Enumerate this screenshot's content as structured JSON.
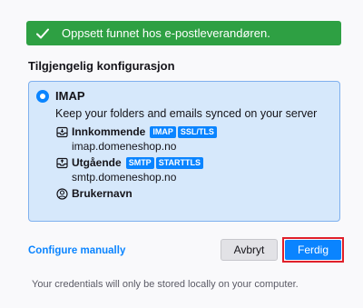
{
  "banner": {
    "text": "Oppsett funnet hos e-postleverandøren.",
    "icon": "check-icon",
    "color": "#2ea043"
  },
  "section": {
    "title": "Tilgjengelig konfigurasjon"
  },
  "config": {
    "protocol": "IMAP",
    "selected": true,
    "description": "Keep your folders and emails synced on your server",
    "incoming": {
      "label": "Innkommende",
      "badges": [
        "IMAP",
        "SSL/TLS"
      ],
      "hostname": "imap.domeneshop.no",
      "icon": "inbox-icon"
    },
    "outgoing": {
      "label": "Utgående",
      "badges": [
        "SMTP",
        "STARTTLS"
      ],
      "hostname": "smtp.domeneshop.no",
      "icon": "outbox-icon"
    },
    "username": {
      "label": "Brukernavn",
      "icon": "user-icon"
    }
  },
  "actions": {
    "configure_manually": "Configure manually",
    "cancel": "Avbryt",
    "done": "Ferdig"
  },
  "footer": {
    "note": "Your credentials will only be stored locally on your computer."
  },
  "colors": {
    "accent": "#0a84ff",
    "highlight": "#e0202a"
  }
}
